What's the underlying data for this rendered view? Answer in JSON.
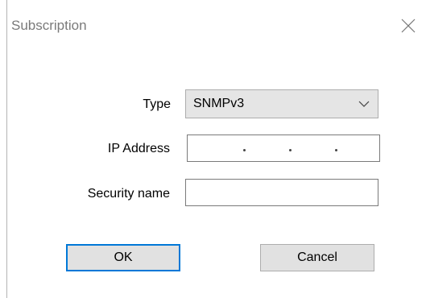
{
  "window": {
    "title": "Subscription"
  },
  "form": {
    "type_label": "Type",
    "type_value": "SNMPv3",
    "ip_label": "IP Address",
    "ip_value": "",
    "security_label": "Security name",
    "security_value": ""
  },
  "buttons": {
    "ok_label": "OK",
    "cancel_label": "Cancel"
  },
  "icons": {
    "close": "close-icon",
    "dropdown": "chevron-down-icon"
  },
  "colors": {
    "focus_accent": "#0078d7"
  }
}
